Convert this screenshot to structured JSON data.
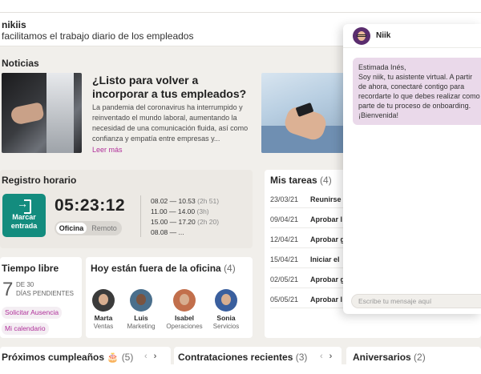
{
  "header": {
    "brand": "nikiis",
    "tagline": "facilitamos el trabajo diario de los empleados"
  },
  "news": {
    "title": "Noticias",
    "headline": "¿Listo para volver a incorporar a tus empleados?",
    "body": "La pandemia del coronavirus ha interrumpido y reinventado el mundo laboral, aumentando la necesidad de una comunicación fluida, así como confianza y empatía entre empresas y...",
    "read_more": "Leer más"
  },
  "clock": {
    "title": "Registro horario",
    "button_label": "Marcar entrada",
    "timer": "05:23:12",
    "mode_on": "Oficina",
    "mode_off": "Remoto",
    "log": [
      {
        "range": "08.02 — 10.53",
        "dur": "(2h 51)"
      },
      {
        "range": "11.00 — 14.00",
        "dur": "(3h)"
      },
      {
        "range": "15.00 — 17.20",
        "dur": "(2h 20)"
      },
      {
        "range": "08.08 — ...",
        "dur": ""
      }
    ]
  },
  "tasks": {
    "title": "Mis tareas",
    "count": "(4)",
    "rows": [
      {
        "date": "23/03/21",
        "name": "Reunirse"
      },
      {
        "date": "09/04/21",
        "name": "Aprobar l"
      },
      {
        "date": "12/04/21",
        "name": "Aprobar g"
      },
      {
        "date": "15/04/21",
        "name": "Iniciar el"
      },
      {
        "date": "02/05/21",
        "name": "Aprobar g"
      },
      {
        "date": "05/05/21",
        "name": "Aprobar l"
      }
    ]
  },
  "leave": {
    "title": "Tiempo libre",
    "days": "7",
    "days_of": "DE 30",
    "days_label": "DÍAS PENDIENTES",
    "request": "Solicitar Ausencia",
    "calendar": "Mi calendario"
  },
  "away": {
    "title": "Hoy están fuera de la oficina",
    "count": "(4)",
    "people": [
      {
        "name": "Marta",
        "dept": "Ventas",
        "color": "#3b3b3b"
      },
      {
        "name": "Luis",
        "dept": "Marketing",
        "color": "#4a6f8c"
      },
      {
        "name": "Isabel",
        "dept": "Operaciones",
        "color": "#c26f4c"
      },
      {
        "name": "Sonia",
        "dept": "Servicios",
        "color": "#3a5f9e"
      }
    ]
  },
  "bottom": {
    "birthdays": "Próximos cumpleaños",
    "birthdays_icon": "🎂",
    "birthdays_count": "(5)",
    "hires": "Contrataciones recientes",
    "hires_count": "(3)",
    "anniversaries": "Aniversarios",
    "anniversaries_count": "(2)"
  },
  "chat": {
    "bot_name": "Niik",
    "message": [
      "Estimada Inés,",
      "Soy niik, tu asistente virtual. A partir",
      "de ahora, conectaré contigo para",
      "recordarte lo que debes realizar como",
      "parte de tu proceso de onboarding.",
      "¡Bienvenida!"
    ],
    "input_placeholder": "Escribe tu mensaje aquí"
  },
  "colors": {
    "accent": "#b0309a",
    "primary": "#138c7e",
    "background": "#f1efeb"
  }
}
